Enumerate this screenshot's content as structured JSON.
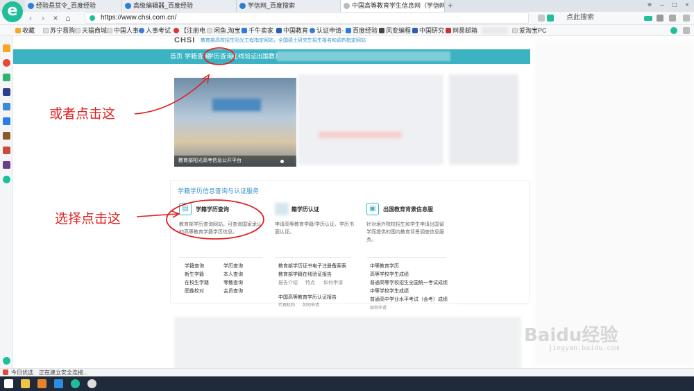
{
  "browser": {
    "tabs": [
      {
        "title": "经验悬赏令_百度经验",
        "active": false
      },
      {
        "title": "高级编辑器_百度经验",
        "active": false
      },
      {
        "title": "学信网_百度搜索",
        "active": false
      },
      {
        "title": "中国高等教育学生信息网（学信网",
        "active": true
      }
    ],
    "new_tab": "+",
    "url": "https://www.chsi.com.cn/",
    "search_placeholder": "点此搜索",
    "bookmarks": [
      "收藏",
      "苏宁易购",
      "天猫商城",
      "中国人事",
      "人事考试",
      "【注册电",
      "闲鱼,淘宝",
      "千牛卖家",
      "中国教育",
      "认证申请-",
      "百度经验",
      "风变编程",
      "中国研究",
      "网易邮箱",
      "爱淘宝PC"
    ],
    "accent": "#1fbf9a"
  },
  "site": {
    "logo": "CHSI",
    "subtitle": "教育部高校招生阳光工程指定网站，全国硕士研究生招生报名和调剂指定网站",
    "nav": [
      "首页",
      "学籍查询",
      "学历查询",
      "在线验证",
      "出国教育背景"
    ],
    "hero_caption": "教育部阳光高考信息公开平台",
    "section_title": "学籍学历信息查询与认证服务",
    "columns": [
      {
        "title": "学籍学历查询",
        "desc": "教育部学历查询网站，可查询国家承认的高等教育学籍学历信息。",
        "links": [
          "学籍查询",
          "学历查询",
          "新生学籍",
          "本人查询",
          "在校生学籍",
          "零散查询",
          "图像校对",
          "会员查询"
        ]
      },
      {
        "title": "籍学历认证",
        "desc": "申请高等教育学籍/学历认证、学历书面认证。",
        "links": [
          "教育部学历证书电子注册备案表",
          "教育部学籍在线验证报告",
          "报告介绍",
          "特点",
          "如何申请",
          "中国高等教育学历认证报告",
          "代理机构",
          "如何申请"
        ]
      },
      {
        "title": "出国教育背景信息服",
        "desc": "针对境外院校招生和学生申请出国留学而提供的国内教育背景调查信息服务。",
        "links": [
          "中等教育学历",
          "高等学校学生成绩",
          "普通高等学校招生全国统一考试成绩",
          "中等学校学生成绩",
          "普通高中学业水平考试（会考）成绩",
          "如何申请"
        ]
      }
    ]
  },
  "annotations": {
    "top": "或者点击这",
    "bottom": "选择点击这"
  },
  "watermark": {
    "brand": "Baidu经验",
    "url": "jingyan.baidu.com"
  },
  "status": {
    "left": "今日优选",
    "loading": "正在建立安全连接..."
  }
}
